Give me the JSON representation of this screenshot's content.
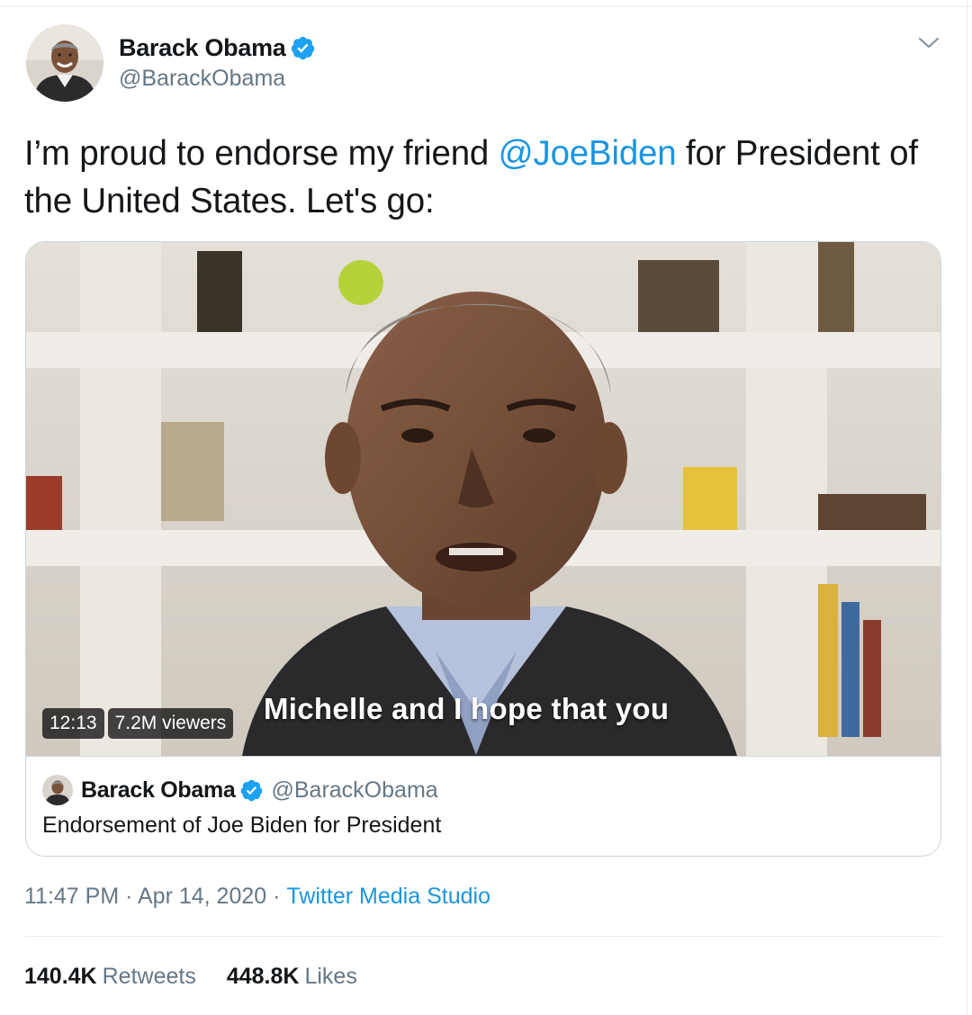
{
  "tweet": {
    "author_name": "Barack Obama",
    "author_handle": "@BarackObama",
    "text_before": "I’m proud to endorse my friend ",
    "mention": "@JoeBiden",
    "text_after": " for President of the United States. Let's go:",
    "timestamp": "11:47 PM · Apr 14, 2020",
    "separator": "·",
    "source": "Twitter Media Studio"
  },
  "media": {
    "duration": "12:13",
    "viewers": "7.2M viewers",
    "caption": "Michelle and I hope that you"
  },
  "card": {
    "author_name": "Barack Obama",
    "author_handle": "@BarackObama",
    "description": "Endorsement of Joe Biden for President"
  },
  "stats": {
    "retweets_count": "140.4K",
    "retweets_label": "Retweets",
    "likes_count": "448.8K",
    "likes_label": "Likes"
  },
  "colors": {
    "link": "#1b95e0",
    "verified": "#1da1f2",
    "secondary_text": "#657786",
    "primary_text": "#14171a"
  },
  "icons": {
    "verified": "verified-badge-icon",
    "menu": "chevron-down-icon"
  }
}
